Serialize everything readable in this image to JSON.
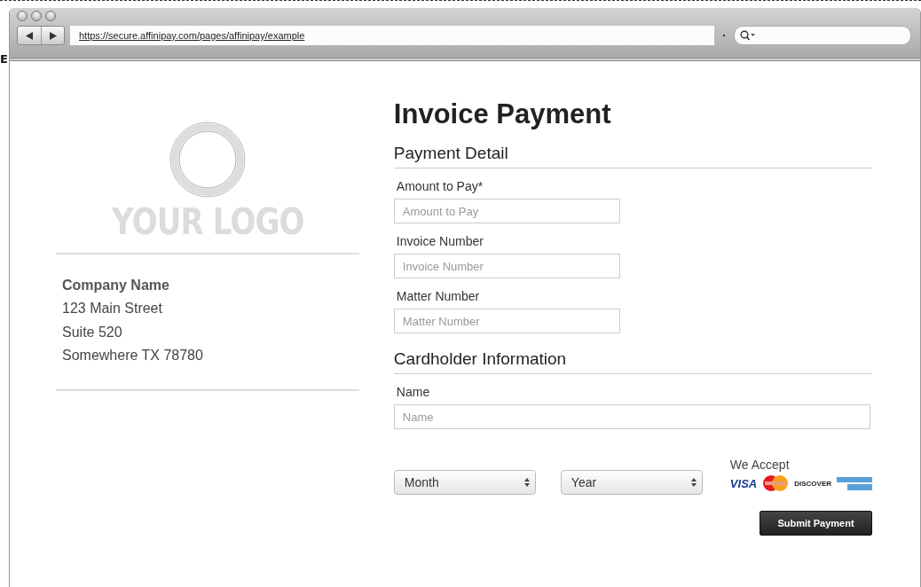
{
  "background_text": "E",
  "browser": {
    "url": "https://secure.affinipay.com/pages/affinipay/example"
  },
  "company": {
    "logo_text": "YOUR LOGO",
    "name": "Company Name",
    "address_lines": [
      "123 Main Street",
      "Suite 520",
      "Somewhere TX 78780"
    ]
  },
  "form": {
    "title": "Invoice Payment",
    "sections": [
      {
        "heading": "Payment Detail",
        "fields": [
          {
            "label": "Amount to Pay*",
            "placeholder": "Amount to Pay",
            "kind": "short"
          },
          {
            "label": "Invoice Number",
            "placeholder": "Invoice Number",
            "kind": "short"
          },
          {
            "label": "Matter Number",
            "placeholder": "Matter Number",
            "kind": "short"
          }
        ]
      },
      {
        "heading": "Cardholder Information",
        "fields": [
          {
            "label": "Name",
            "placeholder": "Name",
            "kind": "wide"
          }
        ]
      }
    ],
    "selects": [
      {
        "value": "Month"
      },
      {
        "value": "Year"
      }
    ],
    "accept_label": "We Accept",
    "card_logos": [
      {
        "kind": "visa",
        "label": "VISA"
      },
      {
        "kind": "mastercard"
      },
      {
        "kind": "discover",
        "label": "DISCOVER"
      },
      {
        "kind": "amex"
      }
    ],
    "submit": "Submit Payment"
  }
}
